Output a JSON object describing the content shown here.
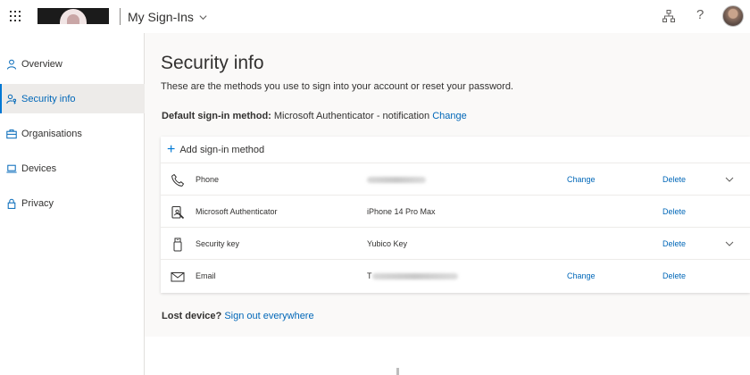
{
  "header": {
    "app_title": "My Sign-Ins",
    "icons": [
      "app-launcher-icon",
      "org-chart-icon",
      "help-icon",
      "user-avatar"
    ],
    "help_glyph": "?"
  },
  "sidebar": {
    "items": [
      {
        "label": "Overview",
        "icon": "person-icon",
        "active": false
      },
      {
        "label": "Security info",
        "icon": "person-key-icon",
        "active": true
      },
      {
        "label": "Organisations",
        "icon": "briefcase-icon",
        "active": false
      },
      {
        "label": "Devices",
        "icon": "laptop-icon",
        "active": false
      },
      {
        "label": "Privacy",
        "icon": "lock-icon",
        "active": false
      }
    ]
  },
  "main": {
    "title": "Security info",
    "subtitle": "These are the methods you use to sign into your account or reset your password.",
    "default_label": "Default sign-in method:",
    "default_value": "Microsoft Authenticator - notification",
    "default_change": "Change",
    "add_method": "Add sign-in method",
    "methods": [
      {
        "name": "Phone",
        "icon": "phone-icon",
        "detail": "",
        "detail_redacted": true,
        "change": "Change",
        "delete": "Delete",
        "expandable": true
      },
      {
        "name": "Microsoft Authenticator",
        "icon": "authenticator-icon",
        "detail": "iPhone 14 Pro Max",
        "detail_redacted": false,
        "change": "",
        "delete": "Delete",
        "expandable": false
      },
      {
        "name": "Security key",
        "icon": "usb-key-icon",
        "detail": "Yubico Key",
        "detail_redacted": false,
        "change": "",
        "delete": "Delete",
        "expandable": true
      },
      {
        "name": "Email",
        "icon": "mail-icon",
        "detail": "T",
        "detail_redacted": true,
        "change": "Change",
        "delete": "Delete",
        "expandable": false
      }
    ],
    "lost_label": "Lost device?",
    "lost_link": "Sign out everywhere"
  },
  "colors": {
    "accent": "#0078d4",
    "link": "#0067b8",
    "text": "#323130",
    "page_bg": "#faf9f8"
  }
}
